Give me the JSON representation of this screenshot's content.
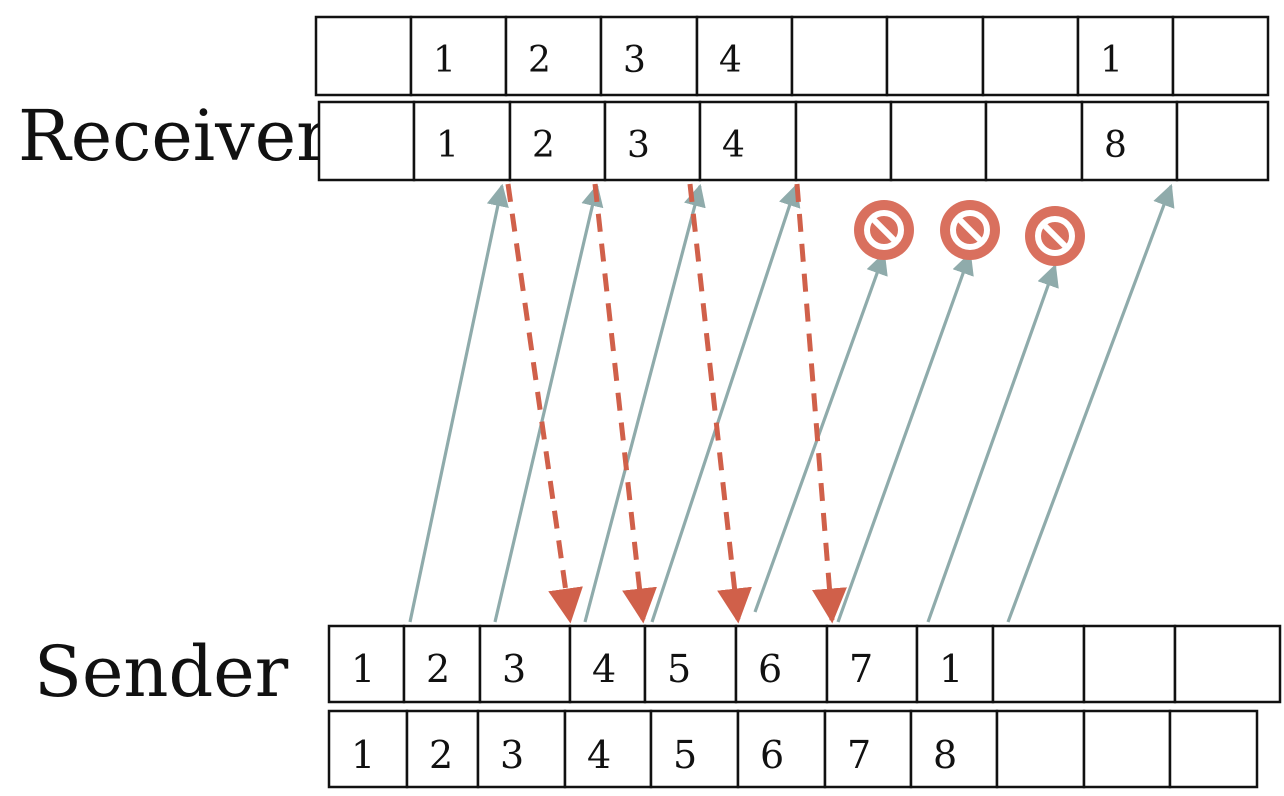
{
  "labels": {
    "receiver": "Receiver",
    "sender": "Sender"
  },
  "rows": {
    "receiver_top": [
      "",
      "1",
      "2",
      "3",
      "4",
      "",
      "",
      "",
      "1",
      ""
    ],
    "receiver_bottom": [
      "",
      "1",
      "2",
      "3",
      "4",
      "",
      "",
      "",
      "8",
      ""
    ],
    "sender_top": [
      "1",
      "2",
      "3",
      "4",
      "5",
      "6",
      "7",
      "1",
      "",
      "",
      ""
    ],
    "sender_bottom": [
      "1",
      "2",
      "3",
      "4",
      "5",
      "6",
      "7",
      "8",
      "",
      "",
      ""
    ]
  },
  "colors": {
    "data_arrow": "#8fabab",
    "ack_arrow": "#d0604a",
    "blocked_icon": "#d9705e",
    "cell_border": "#111111"
  },
  "icons": {
    "blocked": "no-entry-icon"
  }
}
